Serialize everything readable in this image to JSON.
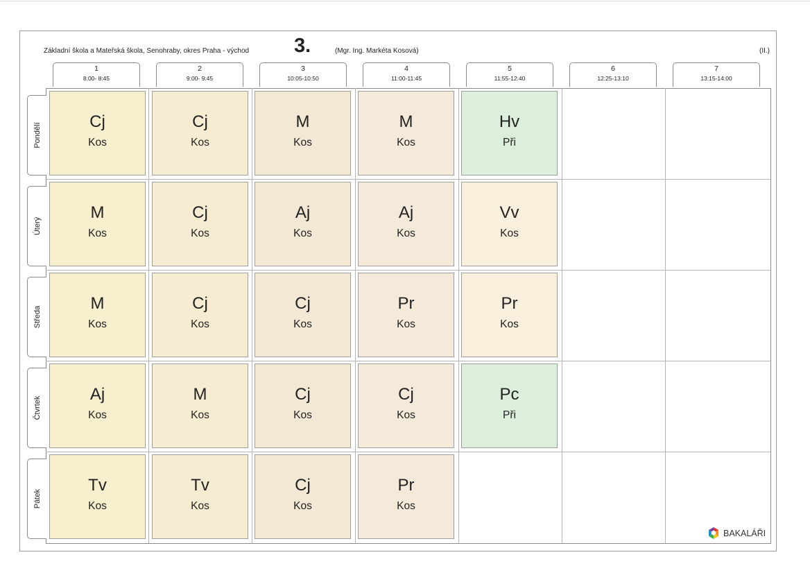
{
  "header": {
    "school": "Základní škola a Mateřská škola, Senohraby, okres Praha - východ",
    "class_number": "3.",
    "teacher": "(Mgr. Ing. Markéta Kosová)",
    "term": "(II.)"
  },
  "periods": [
    {
      "num": "1",
      "time": "8:00- 8:45"
    },
    {
      "num": "2",
      "time": "9:00- 9:45"
    },
    {
      "num": "3",
      "time": "10:05-10:50"
    },
    {
      "num": "4",
      "time": "11:00-11:45"
    },
    {
      "num": "5",
      "time": "11:55-12:40"
    },
    {
      "num": "6",
      "time": "12:25-13:10"
    },
    {
      "num": "7",
      "time": "13:15-14:00"
    }
  ],
  "days": [
    {
      "name": "Pondělí",
      "lessons": [
        {
          "subject": "Cj",
          "teacher": "Kos"
        },
        {
          "subject": "Cj",
          "teacher": "Kos"
        },
        {
          "subject": "M",
          "teacher": "Kos"
        },
        {
          "subject": "M",
          "teacher": "Kos"
        },
        {
          "subject": "Hv",
          "teacher": "Při"
        }
      ]
    },
    {
      "name": "Úterý",
      "lessons": [
        {
          "subject": "M",
          "teacher": "Kos"
        },
        {
          "subject": "Cj",
          "teacher": "Kos"
        },
        {
          "subject": "Aj",
          "teacher": "Kos"
        },
        {
          "subject": "Aj",
          "teacher": "Kos"
        },
        {
          "subject": "Vv",
          "teacher": "Kos"
        }
      ]
    },
    {
      "name": "Středa",
      "lessons": [
        {
          "subject": "M",
          "teacher": "Kos"
        },
        {
          "subject": "Cj",
          "teacher": "Kos"
        },
        {
          "subject": "Cj",
          "teacher": "Kos"
        },
        {
          "subject": "Pr",
          "teacher": "Kos"
        },
        {
          "subject": "Pr",
          "teacher": "Kos"
        }
      ]
    },
    {
      "name": "Čtvrtek",
      "lessons": [
        {
          "subject": "Aj",
          "teacher": "Kos"
        },
        {
          "subject": "M",
          "teacher": "Kos"
        },
        {
          "subject": "Cj",
          "teacher": "Kos"
        },
        {
          "subject": "Cj",
          "teacher": "Kos"
        },
        {
          "subject": "Pc",
          "teacher": "Při"
        }
      ]
    },
    {
      "name": "Pátek",
      "lessons": [
        {
          "subject": "Tv",
          "teacher": "Kos"
        },
        {
          "subject": "Tv",
          "teacher": "Kos"
        },
        {
          "subject": "Cj",
          "teacher": "Kos"
        },
        {
          "subject": "Pr",
          "teacher": "Kos"
        }
      ]
    }
  ],
  "colors": {
    "lesson_warm": "#f8efce",
    "lesson_green": "#dcefdd",
    "grid_line": "#b4b4b4",
    "border": "#8a8a8a"
  },
  "logo": {
    "text": "BAKALÁŘI",
    "icon": "bakalari-hexagon-icon"
  }
}
